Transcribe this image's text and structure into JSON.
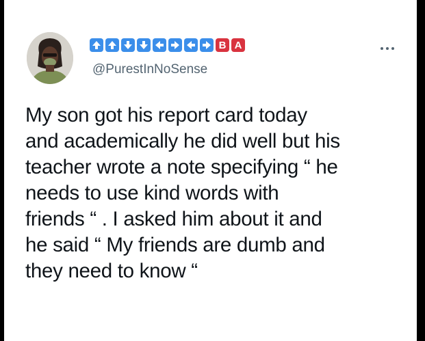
{
  "tweet": {
    "emoji_keys": [
      {
        "icon": "arrow-up-icon",
        "glyph": "up",
        "color": "#3b8eea"
      },
      {
        "icon": "arrow-up-icon",
        "glyph": "up",
        "color": "#3b8eea"
      },
      {
        "icon": "arrow-down-icon",
        "glyph": "down",
        "color": "#3b8eea"
      },
      {
        "icon": "arrow-down-icon",
        "glyph": "down",
        "color": "#3b8eea"
      },
      {
        "icon": "arrow-left-icon",
        "glyph": "left",
        "color": "#3b8eea"
      },
      {
        "icon": "arrow-right-icon",
        "glyph": "right",
        "color": "#3b8eea"
      },
      {
        "icon": "arrow-left-icon",
        "glyph": "left",
        "color": "#3b8eea"
      },
      {
        "icon": "arrow-right-icon",
        "glyph": "right",
        "color": "#3b8eea"
      }
    ],
    "letter_keys": [
      "B",
      "A"
    ],
    "letter_key_color": "#d9333f",
    "handle": "@PurestInNoSense",
    "text_lines": [
      "My son got his report card today",
      "and academically he did well but his",
      "teacher wrote a note specifying “ he",
      "needs to use kind words with",
      "friends “ . I asked him about it and",
      "he said “ My friends are dumb and",
      "they need to know “"
    ]
  }
}
